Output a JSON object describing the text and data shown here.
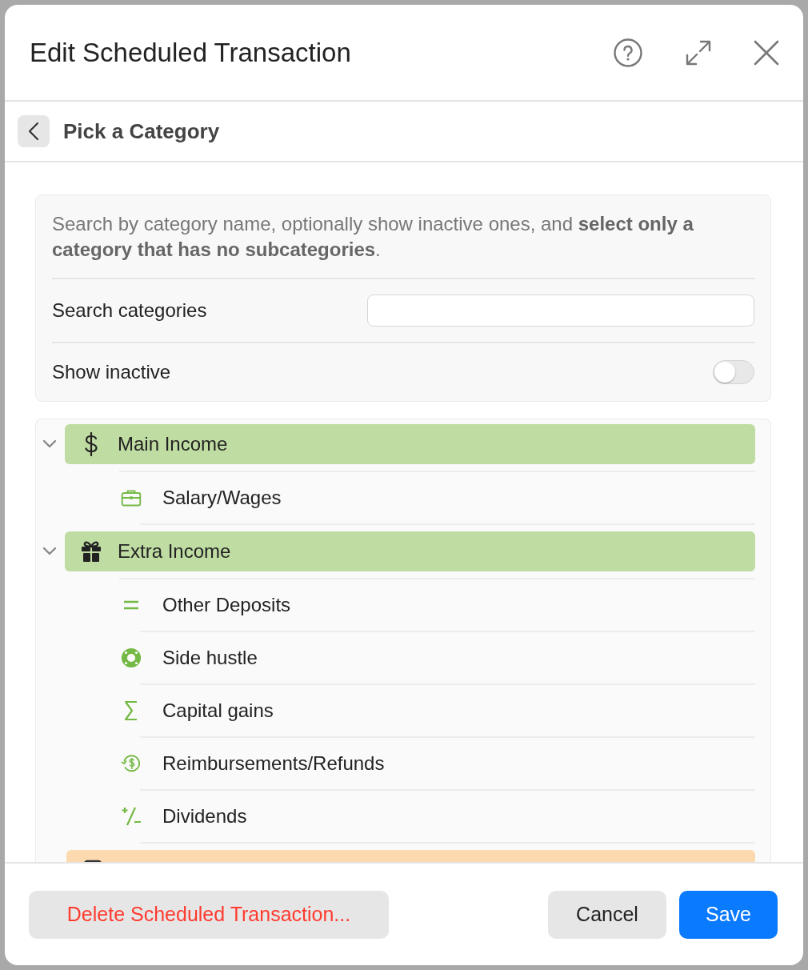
{
  "dialog": {
    "title": "Edit Scheduled Transaction"
  },
  "subheader": {
    "title": "Pick a Category"
  },
  "intro": {
    "text": "Search by category name, optionally show inactive ones, and **select only a category that has no subcategories**."
  },
  "search": {
    "label": "Search categories"
  },
  "show_inactive": {
    "label": "Show inactive",
    "on": false
  },
  "categories": [
    {
      "label": "Main Income",
      "color": "#bfdca2",
      "expanded": true,
      "children": [
        {
          "label": "Salary/Wages"
        }
      ]
    },
    {
      "label": "Extra Income",
      "color": "#bfdca2",
      "expanded": true,
      "children": [
        {
          "label": "Other Deposits"
        },
        {
          "label": "Side hustle"
        },
        {
          "label": "Capital gains"
        },
        {
          "label": "Reimbursements/Refunds"
        },
        {
          "label": "Dividends"
        }
      ]
    },
    {
      "color": "#fdd9b0"
    }
  ],
  "footer": {
    "delete_button": "Delete Scheduled Transaction...",
    "cancel_button": "Cancel",
    "save_button": "Save"
  }
}
